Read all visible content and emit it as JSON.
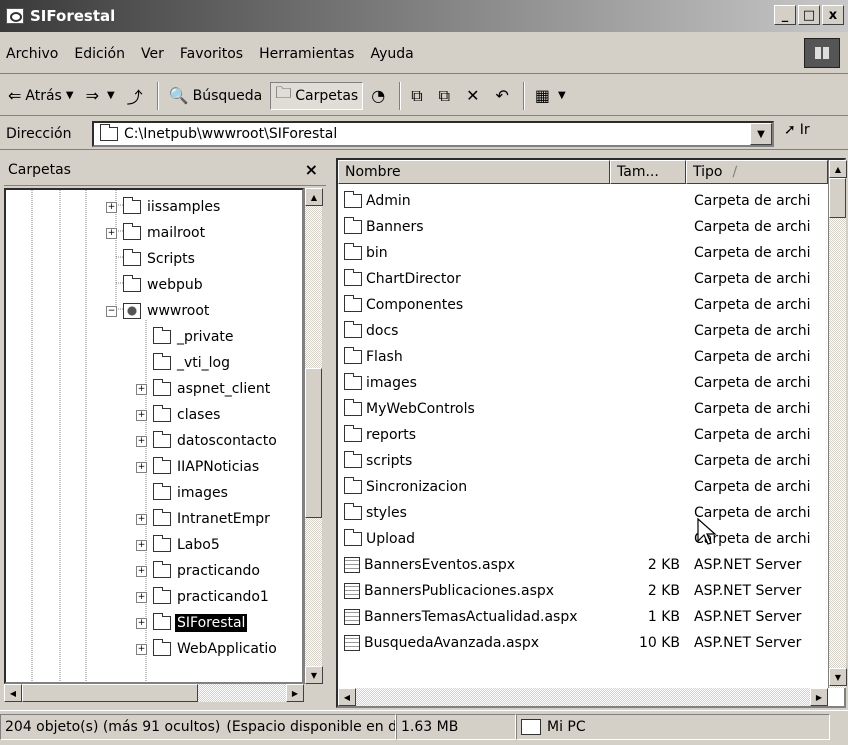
{
  "window": {
    "title": "SIForestal"
  },
  "title_buttons": [
    "_",
    "□",
    "x"
  ],
  "menu": [
    "Archivo",
    "Edición",
    "Ver",
    "Favoritos",
    "Herramientas",
    "Ayuda"
  ],
  "toolbar": {
    "back": "Atrás",
    "search": "Búsqueda",
    "folders": "Carpetas"
  },
  "address": {
    "label": "Dirección",
    "path": "C:\\Inetpub\\wwwroot\\SIForestal",
    "go": "Ir"
  },
  "folders_pane": {
    "title": "Carpetas",
    "close": "×",
    "items": [
      {
        "label": "iissamples",
        "expand": "+"
      },
      {
        "label": "mailroot",
        "expand": "+"
      },
      {
        "label": "Scripts",
        "expand": ""
      },
      {
        "label": "webpub",
        "expand": ""
      },
      {
        "label": "wwwroot",
        "expand": "−"
      },
      {
        "label": "_private",
        "expand": ""
      },
      {
        "label": "_vti_log",
        "expand": ""
      },
      {
        "label": "aspnet_client",
        "expand": "+"
      },
      {
        "label": "clases",
        "expand": "+"
      },
      {
        "label": "datoscontacto",
        "expand": "+"
      },
      {
        "label": "IIAPNoticias",
        "expand": "+"
      },
      {
        "label": "images",
        "expand": ""
      },
      {
        "label": "IntranetEmpr",
        "expand": "+"
      },
      {
        "label": "Labo5",
        "expand": "+"
      },
      {
        "label": "practicando",
        "expand": "+"
      },
      {
        "label": "practicando1",
        "expand": "+"
      },
      {
        "label": "SIForestal",
        "expand": "+"
      },
      {
        "label": "WebApplicatio",
        "expand": "+"
      }
    ]
  },
  "columns": {
    "name": "Nombre",
    "size": "Tam...",
    "type": "Tipo"
  },
  "files": [
    {
      "name": "Admin",
      "size": "",
      "type": "Carpeta de archi",
      "kind": "folder"
    },
    {
      "name": "Banners",
      "size": "",
      "type": "Carpeta de archi",
      "kind": "folder"
    },
    {
      "name": "bin",
      "size": "",
      "type": "Carpeta de archi",
      "kind": "folder"
    },
    {
      "name": "ChartDirector",
      "size": "",
      "type": "Carpeta de archi",
      "kind": "folder"
    },
    {
      "name": "Componentes",
      "size": "",
      "type": "Carpeta de archi",
      "kind": "folder"
    },
    {
      "name": "docs",
      "size": "",
      "type": "Carpeta de archi",
      "kind": "folder"
    },
    {
      "name": "Flash",
      "size": "",
      "type": "Carpeta de archi",
      "kind": "folder"
    },
    {
      "name": "images",
      "size": "",
      "type": "Carpeta de archi",
      "kind": "folder"
    },
    {
      "name": "MyWebControls",
      "size": "",
      "type": "Carpeta de archi",
      "kind": "folder"
    },
    {
      "name": "reports",
      "size": "",
      "type": "Carpeta de archi",
      "kind": "folder"
    },
    {
      "name": "scripts",
      "size": "",
      "type": "Carpeta de archi",
      "kind": "folder"
    },
    {
      "name": "Sincronizacion",
      "size": "",
      "type": "Carpeta de archi",
      "kind": "folder"
    },
    {
      "name": "styles",
      "size": "",
      "type": "Carpeta de archi",
      "kind": "folder"
    },
    {
      "name": "Upload",
      "size": "",
      "type": "Carpeta de archi",
      "kind": "folder"
    },
    {
      "name": "BannersEventos.aspx",
      "size": "2 KB",
      "type": "ASP.NET Server",
      "kind": "aspx"
    },
    {
      "name": "BannersPublicaciones.aspx",
      "size": "2 KB",
      "type": "ASP.NET Server",
      "kind": "aspx"
    },
    {
      "name": "BannersTemasActualidad.aspx",
      "size": "1 KB",
      "type": "ASP.NET Server",
      "kind": "aspx"
    },
    {
      "name": "BusquedaAvanzada.aspx",
      "size": "10 KB",
      "type": "ASP.NET Server",
      "kind": "aspx"
    }
  ],
  "status": {
    "objects": "204 objeto(s) (más 91 ocultos)",
    "space_label": "(Espacio disponible en disco",
    "space_value": "1.63 MB",
    "computer": "Mi PC"
  }
}
